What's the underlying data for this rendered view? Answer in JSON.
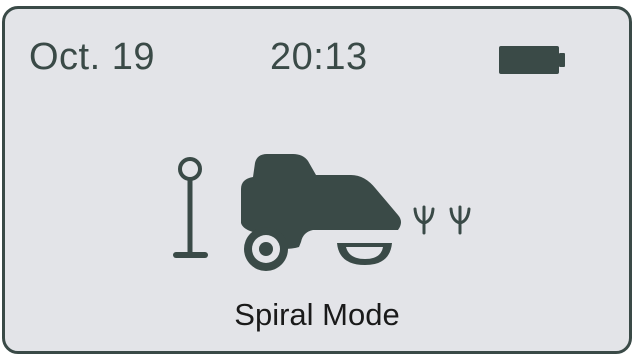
{
  "status_bar": {
    "date": "Oct. 19",
    "time": "20:13",
    "battery_icon": "battery-full-icon"
  },
  "illustration": {
    "marker_icon": "boundary-marker-icon",
    "mower_icon": "robot-mower-icon",
    "grass_icon": "grass-icon"
  },
  "mode": {
    "label": "Spiral Mode"
  },
  "colors": {
    "screen_background": "#e3e4e8",
    "border": "#3a4a47",
    "icon_fill": "#3a4a47",
    "label_text": "#1a1a1a"
  }
}
